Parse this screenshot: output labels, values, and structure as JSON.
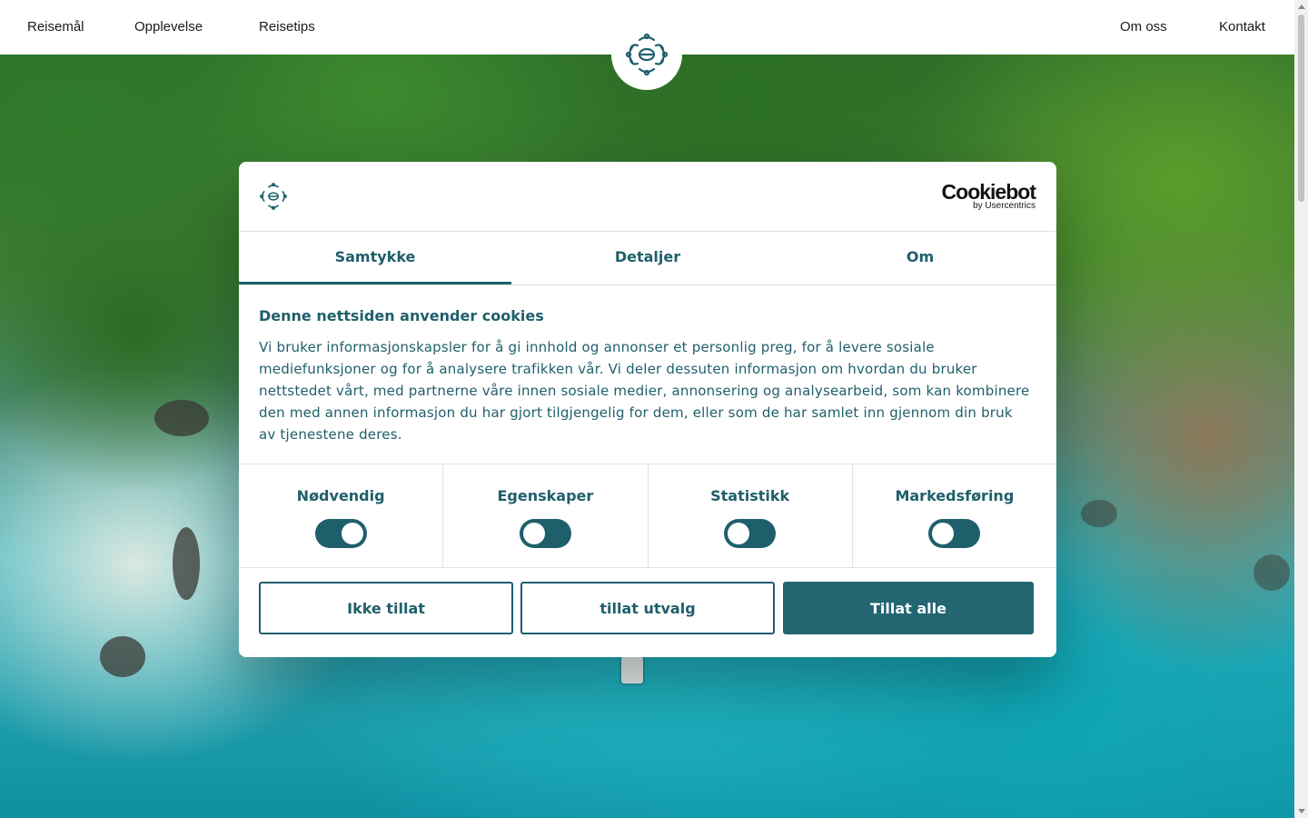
{
  "header": {
    "nav_left": [
      "Reisemål",
      "Opplevelse",
      "Reisetips"
    ],
    "nav_right": [
      "Om oss",
      "Kontakt"
    ]
  },
  "cookie_dialog": {
    "brand": {
      "name": "Cookiebot",
      "sub": "by Usercentrics"
    },
    "tabs": [
      {
        "label": "Samtykke",
        "active": true
      },
      {
        "label": "Detaljer",
        "active": false
      },
      {
        "label": "Om",
        "active": false
      }
    ],
    "title": "Denne nettsiden anvender cookies",
    "body": "Vi bruker informasjonskapsler for å gi innhold og annonser et personlig preg, for å levere sosiale mediefunksjoner og for å analysere trafikken vår. Vi deler dessuten informasjon om hvordan du bruker nettstedet vårt, med partnerne våre innen sosiale medier, annonsering og analysearbeid, som kan kombinere den med annen informasjon du har gjort tilgjengelig for dem, eller som de har samlet inn gjennom din bruk av tjenestene deres.",
    "toggles": [
      {
        "label": "Nødvendig",
        "on": true
      },
      {
        "label": "Egenskaper",
        "on": false
      },
      {
        "label": "Statistikk",
        "on": false
      },
      {
        "label": "Markedsføring",
        "on": false
      }
    ],
    "buttons": {
      "deny": "Ikke tillat",
      "allow_selection": "tillat utvalg",
      "allow_all": "Tillat alle"
    }
  },
  "colors": {
    "brand_teal": "#1f5f6b",
    "button_solid": "#236570"
  }
}
